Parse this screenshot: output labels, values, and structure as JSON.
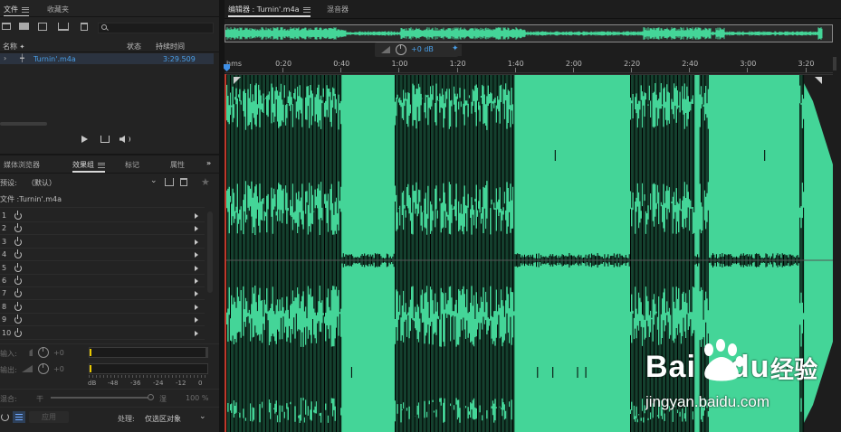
{
  "files_panel": {
    "tabs": [
      "文件",
      "收藏夹"
    ],
    "search_placeholder": "",
    "columns": {
      "name": "名称",
      "status": "状态",
      "duration": "持续时间"
    },
    "files": [
      {
        "name": "Turnin'.m4a",
        "status": "",
        "duration": "3:29.509"
      }
    ]
  },
  "effects_panel": {
    "tabs": [
      "媒体浏览器",
      "效果组",
      "标记",
      "属性"
    ],
    "preset_label": "预设:",
    "preset_value": "（默认）",
    "file_label": "文件 :Turnin'.m4a",
    "slots": [
      "1",
      "2",
      "3",
      "4",
      "5",
      "6",
      "7",
      "8",
      "9",
      "10"
    ],
    "input_label": "输入:",
    "output_label": "输出:",
    "input_db": "+0",
    "output_db": "+0",
    "meter_scale": [
      "dB",
      "-48",
      "-36",
      "-24",
      "-12",
      "0"
    ],
    "mix_label": "混合:",
    "mix_dry": "干",
    "mix_wet": "湿",
    "mix_value": "100 %",
    "mix_level": 1.0,
    "apply_label": "应用",
    "process_label": "处理:",
    "process_value": "仅选区对象"
  },
  "editor": {
    "tabs": [
      "编辑器 : Turnin'.m4a",
      "混音器"
    ],
    "hud_volume": "+0 dB",
    "ruler_unit": "hms",
    "ruler_labels": [
      "0:20",
      "0:40",
      "1:00",
      "1:20",
      "1:40",
      "2:00",
      "2:20",
      "2:40",
      "3:00",
      "3:20"
    ],
    "ruler_seconds": [
      20,
      40,
      60,
      80,
      100,
      120,
      140,
      160,
      180,
      200
    ],
    "total_seconds": 209.5,
    "waveform_color": "#44d598",
    "background_color": "#1d1d1d"
  },
  "watermark": {
    "brand": "Bai",
    "brand_mid": "du",
    "brand_cn": "经验",
    "url": "jingyan.baidu.com"
  }
}
